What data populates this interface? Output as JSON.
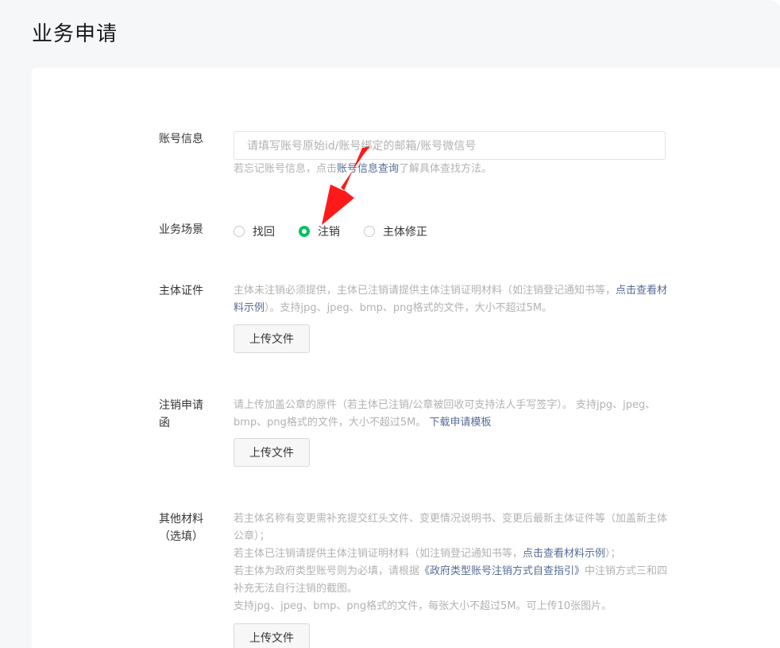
{
  "page": {
    "title": "业务申请"
  },
  "account": {
    "label": "账号信息",
    "placeholder": "请填写账号原始id/账号绑定的邮箱/账号微信号",
    "hint_prefix": "若忘记账号信息，点击",
    "hint_link": "账号信息查询",
    "hint_suffix": "了解具体查找方法。"
  },
  "scenario": {
    "label": "业务场景",
    "options": [
      {
        "label": "找回",
        "checked": false
      },
      {
        "label": "注销",
        "checked": true
      },
      {
        "label": "主体修正",
        "checked": false
      }
    ]
  },
  "certificate": {
    "label": "主体证件",
    "hint_prefix": "主体未注销必须提供，主体已注销请提供主体注销证明材料（如注销登记通知书等，",
    "hint_link": "点击查看材料示例",
    "hint_suffix": "）。支持jpg、jpeg、bmp、png格式的文件，大小不超过5M。",
    "upload_label": "上传文件"
  },
  "letter": {
    "label": "注销申请函",
    "hint": "请上传加盖公章的原件（若主体已注销/公章被回收可支持法人手写签字）。 支持jpg、jpeg、bmp、png格式的文件，大小不超过5M。",
    "hint_link": "下载申请模板",
    "upload_label": "上传文件"
  },
  "other": {
    "label": "其他材料（选填）",
    "line1": "若主体名称有变更需补充提交红头文件、变更情况说明书、变更后最新主体证件等（加盖新主体公章）；",
    "line2_prefix": "若主体已注销请提供主体注销证明材料（如注销登记通知书等，",
    "line2_link": "点击查看材料示例",
    "line2_suffix": "）；",
    "line3_prefix": "若主体为政府类型账号则为必填，请根据",
    "line3_link": "《政府类型账号注销方式自查指引》",
    "line3_suffix": "中注销方式三和四补充无法自行注销的截图。",
    "line4": "支持jpg、jpeg、bmp、png格式的文件，每张大小不超过5M。可上传10张图片。",
    "upload_label": "上传文件"
  },
  "colors": {
    "accent": "#07c160",
    "link": "#576b95",
    "arrow": "#ff1a1a",
    "hint": "#b2b2b2"
  }
}
